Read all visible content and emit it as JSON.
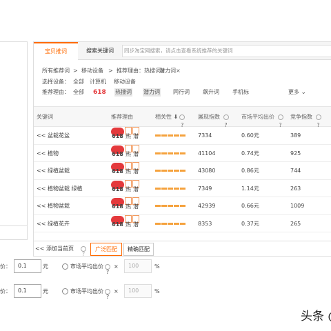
{
  "tabs": [
    {
      "label": "宝贝推词",
      "active": true
    },
    {
      "label": "搜索关键词",
      "active": false
    }
  ],
  "search": {
    "placeholder": "同步淘宝网搜索，请点击查看系统推荐的关键词"
  },
  "filters": {
    "breadcrumb": {
      "all": "所有推荐词",
      "sep": ">",
      "device": "移动设备",
      "reason": "推荐理由：热搜词×",
      "potential": "潜力词×"
    },
    "device": {
      "label": "选择设备：",
      "options": [
        "全部",
        "计算机",
        "移动设备"
      ]
    },
    "reason": {
      "label": "推荐理由：",
      "options": [
        "全部",
        "618",
        "热搜词",
        "潜力词",
        "同行词",
        "飙升词",
        "手机标"
      ],
      "more": "更多"
    }
  },
  "table": {
    "columns": [
      "关键词",
      "推荐理由",
      "相关性",
      "展现指数",
      "市场平均出价",
      "竞争指数"
    ],
    "rows": [
      {
        "keyword": "<< 盆栽花盆",
        "badge": "618",
        "tag1": "热",
        "tag2": "潜",
        "impression": "7334",
        "price": "0.60元",
        "competition": "389"
      },
      {
        "keyword": "<< 植物",
        "badge": "618",
        "tag1": "热",
        "tag2": "潜",
        "impression": "41104",
        "price": "0.74元",
        "competition": "925"
      },
      {
        "keyword": "<< 绿植盆栽",
        "badge": "618",
        "tag1": "热",
        "tag2": "潜",
        "impression": "43080",
        "price": "0.86元",
        "competition": "744"
      },
      {
        "keyword": "<< 植物盆栽 绿植",
        "badge": "618",
        "tag1": "热",
        "tag2": "潜",
        "impression": "7349",
        "price": "1.14元",
        "competition": "263"
      },
      {
        "keyword": "<< 植物盆栽",
        "badge": "618",
        "tag1": "热",
        "tag2": "潜",
        "impression": "42939",
        "price": "0.66元",
        "competition": "1009"
      },
      {
        "keyword": "<< 绿植花卉",
        "badge": "618",
        "tag1": "热",
        "tag2": "潜",
        "impression": "8353",
        "price": "0.37元",
        "competition": "265"
      }
    ]
  },
  "bottom": {
    "add_page": "<< 添加当前页",
    "broad": "广泛匹配",
    "exact": "精确匹配"
  },
  "price_rows": [
    {
      "prefix": "价：",
      "value": "0.1",
      "unit": "元",
      "market_label": "市场平均出价",
      "times": "×",
      "percent_value": "100",
      "percent": "%"
    },
    {
      "prefix": "价：",
      "value": "0.1",
      "unit": "元",
      "market_label": "市场平均出价",
      "times": "×",
      "percent_value": "100",
      "percent": "%"
    }
  ],
  "watermark": "头条 @",
  "colors": {
    "accent": "#ff6a00",
    "badge_red": "#e4393c",
    "relevance_bar": "#f5a23d",
    "sort_blue": "#2a70d6"
  }
}
